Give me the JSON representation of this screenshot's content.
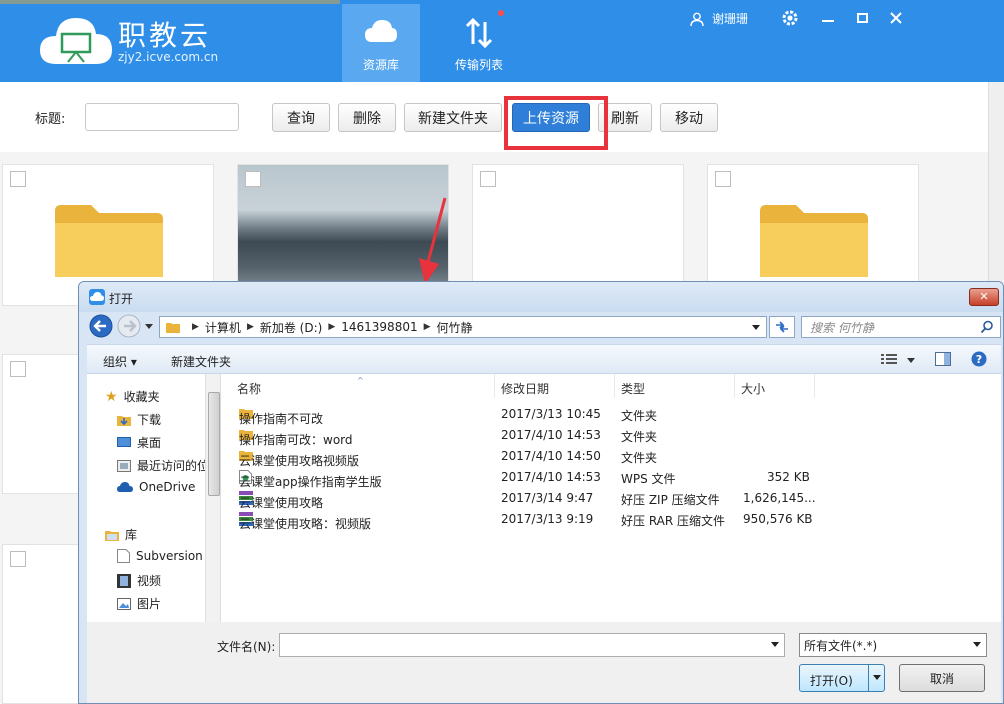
{
  "app": {
    "brand": "职教云",
    "url": "zjy2.icve.com.cn",
    "tabs": [
      {
        "label": "资源库",
        "active": true
      },
      {
        "label": "传输列表",
        "active": false
      }
    ],
    "user": "谢珊珊",
    "colors": {
      "header": "#2f8ee8",
      "accent": "#2f7fd8",
      "highlight": "#e8323c"
    }
  },
  "toolbar": {
    "title_label": "标题:",
    "title_value": "",
    "buttons": [
      "查询",
      "删除",
      "新建文件夹",
      "上传资源",
      "刷新",
      "移动"
    ]
  },
  "dialog": {
    "title": "打开",
    "breadcrumb": [
      "计算机",
      "新加卷 (D:)",
      "1461398801",
      "何竹静"
    ],
    "search_placeholder": "搜索 何竹静",
    "commands": {
      "organize": "组织 ▾",
      "new_folder": "新建文件夹"
    },
    "nav": {
      "favorites": "收藏夹",
      "items": [
        "下载",
        "桌面",
        "最近访问的位置",
        "OneDrive"
      ],
      "libraries": "库",
      "lib_items": [
        "Subversion",
        "视频",
        "图片"
      ]
    },
    "columns": {
      "name": "名称",
      "date": "修改日期",
      "type": "类型",
      "size": "大小"
    },
    "files": [
      {
        "name": "操作指南不可改",
        "date": "2017/3/13 10:45",
        "type": "文件夹",
        "size": "",
        "icon": "folder-icon"
      },
      {
        "name": "操作指南可改：word",
        "date": "2017/4/10 14:53",
        "type": "文件夹",
        "size": "",
        "icon": "folder-icon"
      },
      {
        "name": "云课堂使用攻略视频版",
        "date": "2017/4/10 14:50",
        "type": "文件夹",
        "size": "",
        "icon": "folder-icon"
      },
      {
        "name": "云课堂app操作指南学生版",
        "date": "2017/4/10 14:53",
        "type": "WPS 文件",
        "size": "352 KB",
        "icon": "wps-doc-icon"
      },
      {
        "name": "云课堂使用攻略",
        "date": "2017/3/14 9:47",
        "type": "好压 ZIP 压缩文件",
        "size": "1,626,145...",
        "icon": "zip-archive-icon"
      },
      {
        "name": "云课堂使用攻略：视频版",
        "date": "2017/3/13 9:19",
        "type": "好压 RAR 压缩文件",
        "size": "950,576 KB",
        "icon": "rar-archive-icon"
      }
    ],
    "filename_label": "文件名(N):",
    "filename_value": "",
    "filetype": "所有文件(*.*)",
    "open_label": "打开(O)",
    "cancel_label": "取消"
  }
}
